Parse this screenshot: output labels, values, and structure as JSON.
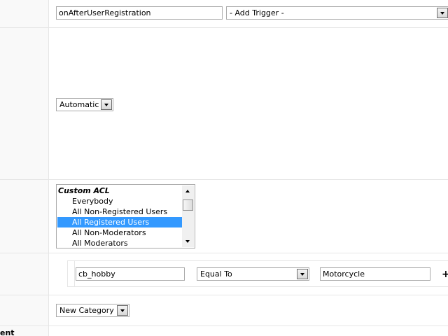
{
  "trigger_row": {
    "trigger_value": "onAfterUserRegistration",
    "add_trigger_selected": "- Add Trigger -"
  },
  "type_row": {
    "type_selected": "Automatic"
  },
  "access_row": {
    "group_label": "Custom ACL",
    "items": [
      {
        "label": "Everybody",
        "selected": false
      },
      {
        "label": "All Non-Registered Users",
        "selected": false
      },
      {
        "label": "All Registered Users",
        "selected": true
      },
      {
        "label": "All Non-Moderators",
        "selected": false
      },
      {
        "label": "All Moderators",
        "selected": false
      }
    ],
    "selection_color": "#3399ff"
  },
  "conditions_row": {
    "field_value": "cb_hobby",
    "operator_selected": "Equal To",
    "compare_value": "Motorcycle",
    "add_symbol": "+"
  },
  "category_row": {
    "category_selected": "New Category"
  },
  "cut_off_label": "ent",
  "icons": [
    "dropdown-arrow-icon",
    "scroll-up-icon",
    "scroll-down-icon",
    "plus-icon"
  ]
}
